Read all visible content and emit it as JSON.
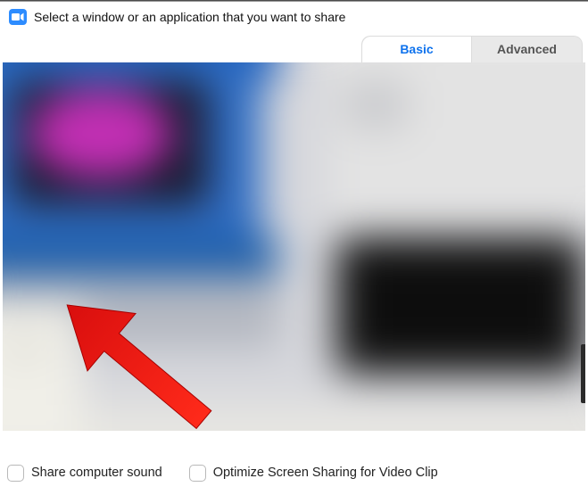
{
  "header": {
    "title": "Select a window or an application that you want to share"
  },
  "tabs": {
    "basic": "Basic",
    "advanced": "Advanced"
  },
  "options": {
    "share_sound": "Share computer sound",
    "optimize_video": "Optimize Screen Sharing for Video Clip"
  }
}
